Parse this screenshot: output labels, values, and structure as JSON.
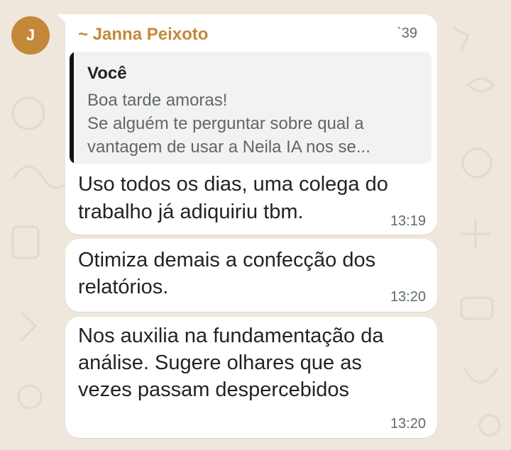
{
  "chat": {
    "sender": {
      "avatar_letter": "J",
      "name": "~ Janna Peixoto",
      "time_partial": "`39",
      "color": "#c4883a"
    },
    "messages": [
      {
        "quote": {
          "author": "Você",
          "lines": [
            "Boa tarde amoras!",
            "Se alguém te perguntar sobre qual a",
            "vantagem de usar a Neila IA nos se..."
          ]
        },
        "lines": [
          "Uso todos os dias, uma colega do",
          "trabalho já adiquiriu tbm."
        ],
        "time": "13:19"
      },
      {
        "lines": [
          "Otimiza demais a confecção dos",
          "relatórios."
        ],
        "time": "13:20"
      },
      {
        "lines": [
          "Nos auxilia na fundamentação da",
          "análise. Sugere olhares que as",
          "vezes passam despercebidos"
        ],
        "time": "13:20"
      }
    ]
  },
  "colors": {
    "wallpaper": "#efe7dc",
    "bubble": "#ffffff",
    "quote_background": "#f2f2f2",
    "quote_bar": "#111111",
    "timestamp": "#606b70"
  }
}
